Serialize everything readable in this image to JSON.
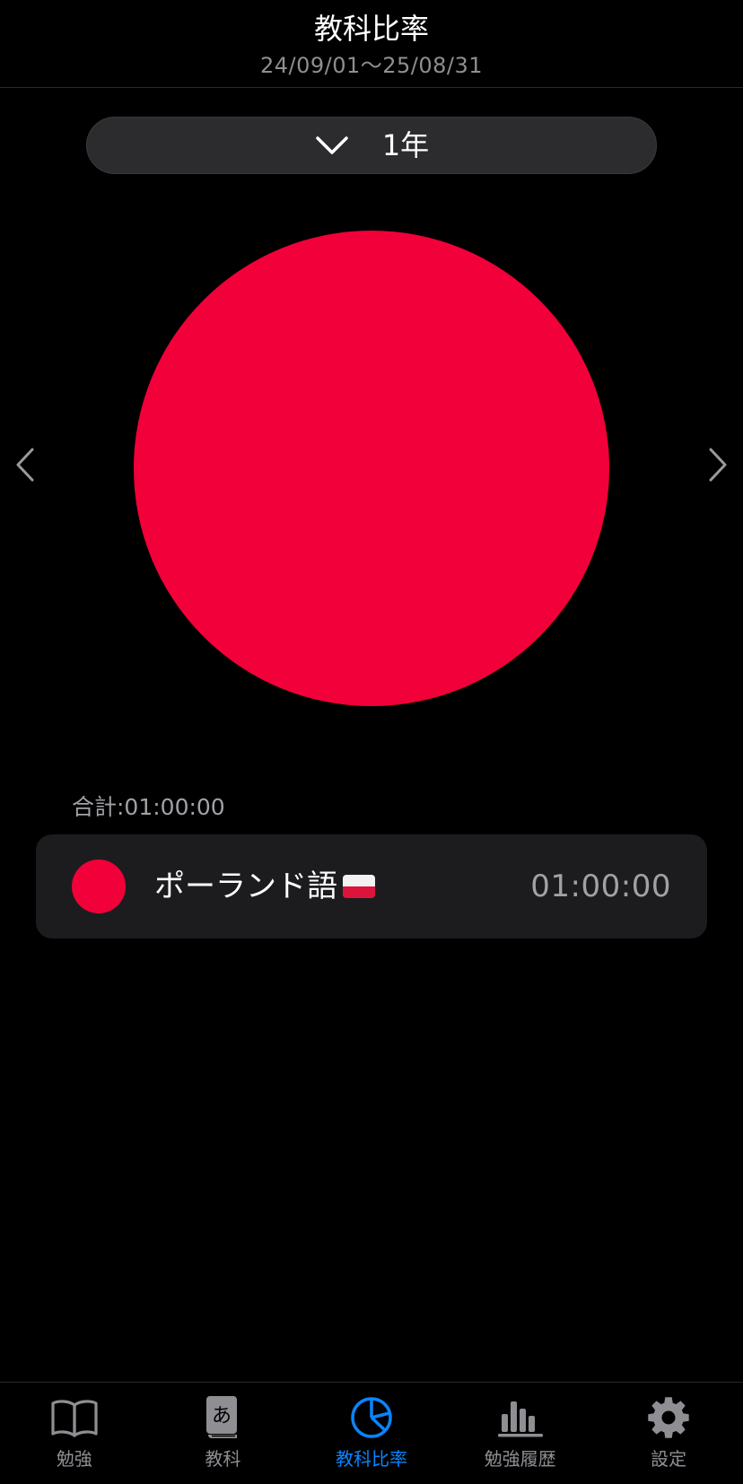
{
  "header": {
    "title": "教科比率",
    "date_range": "24/09/01～25/08/31"
  },
  "period_selector": {
    "selected": "1年",
    "icon": "chevron-down-icon"
  },
  "nav": {
    "prev_icon": "chevron-left-icon",
    "next_icon": "chevron-right-icon"
  },
  "chart_data": {
    "type": "pie",
    "categories": [
      "ポーランド語🇵🇱"
    ],
    "values": [
      1
    ],
    "colors": [
      "#f20039"
    ]
  },
  "summary": {
    "total_label": "合計:01:00:00"
  },
  "subjects": [
    {
      "name": "ポーランド語",
      "flag": "poland-flag-icon",
      "time": "01:00:00",
      "color": "#f20039"
    }
  ],
  "tabs": [
    {
      "label": "勉強",
      "icon": "open-book-icon",
      "active": false
    },
    {
      "label": "教科",
      "icon": "hiragana-book-icon",
      "active": false
    },
    {
      "label": "教科比率",
      "icon": "pie-chart-icon",
      "active": true
    },
    {
      "label": "勉強履歴",
      "icon": "bar-chart-icon",
      "active": false
    },
    {
      "label": "設定",
      "icon": "gear-icon",
      "active": false
    }
  ],
  "colors": {
    "accent": "#0a84ff",
    "tab_inactive": "#8e8e93",
    "slice": "#f20039",
    "row_bg": "#1c1c1e"
  }
}
